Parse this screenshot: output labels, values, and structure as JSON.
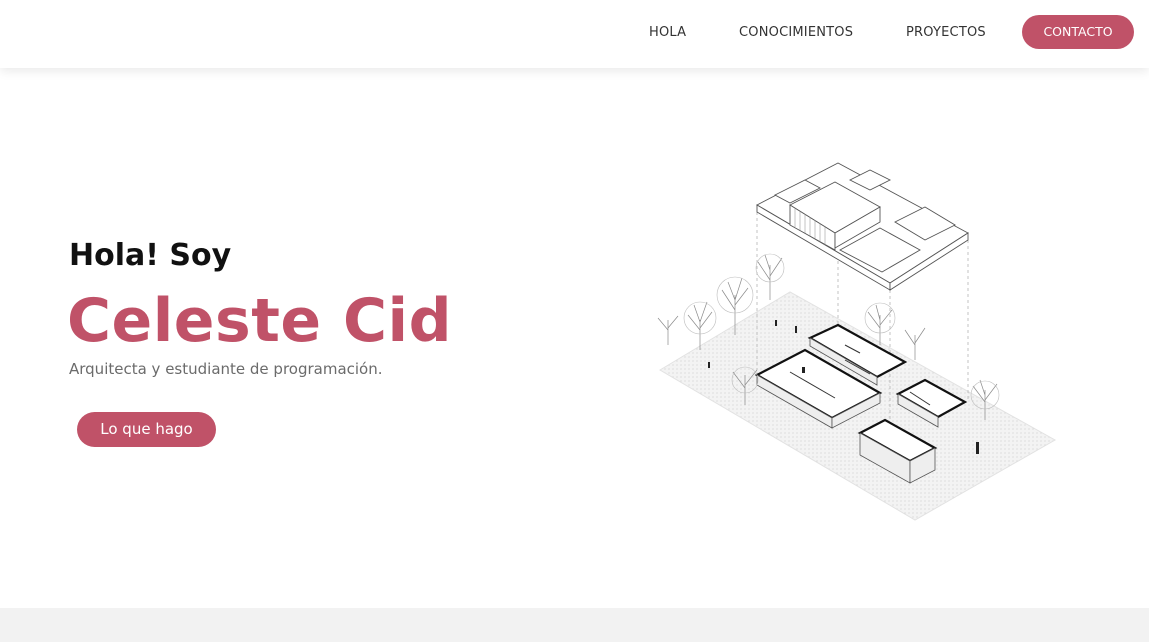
{
  "nav": {
    "items": [
      {
        "label": "HOLA"
      },
      {
        "label": "CONOCIMIENTOS"
      },
      {
        "label": "PROYECTOS"
      }
    ],
    "cta_label": "CONTACTO"
  },
  "hero": {
    "greeting": "Hola! Soy",
    "name": "Celeste Cid",
    "subtitle": "Arquitecta y estudiante de programación.",
    "button_label": "Lo que hago"
  },
  "colors": {
    "accent": "#c05268",
    "text_dark": "#111111",
    "text_muted": "#6b6b6b",
    "footer_bg": "#f2f2f2"
  },
  "illustration": {
    "subject": "isometric exploded architectural drawing of a house"
  }
}
